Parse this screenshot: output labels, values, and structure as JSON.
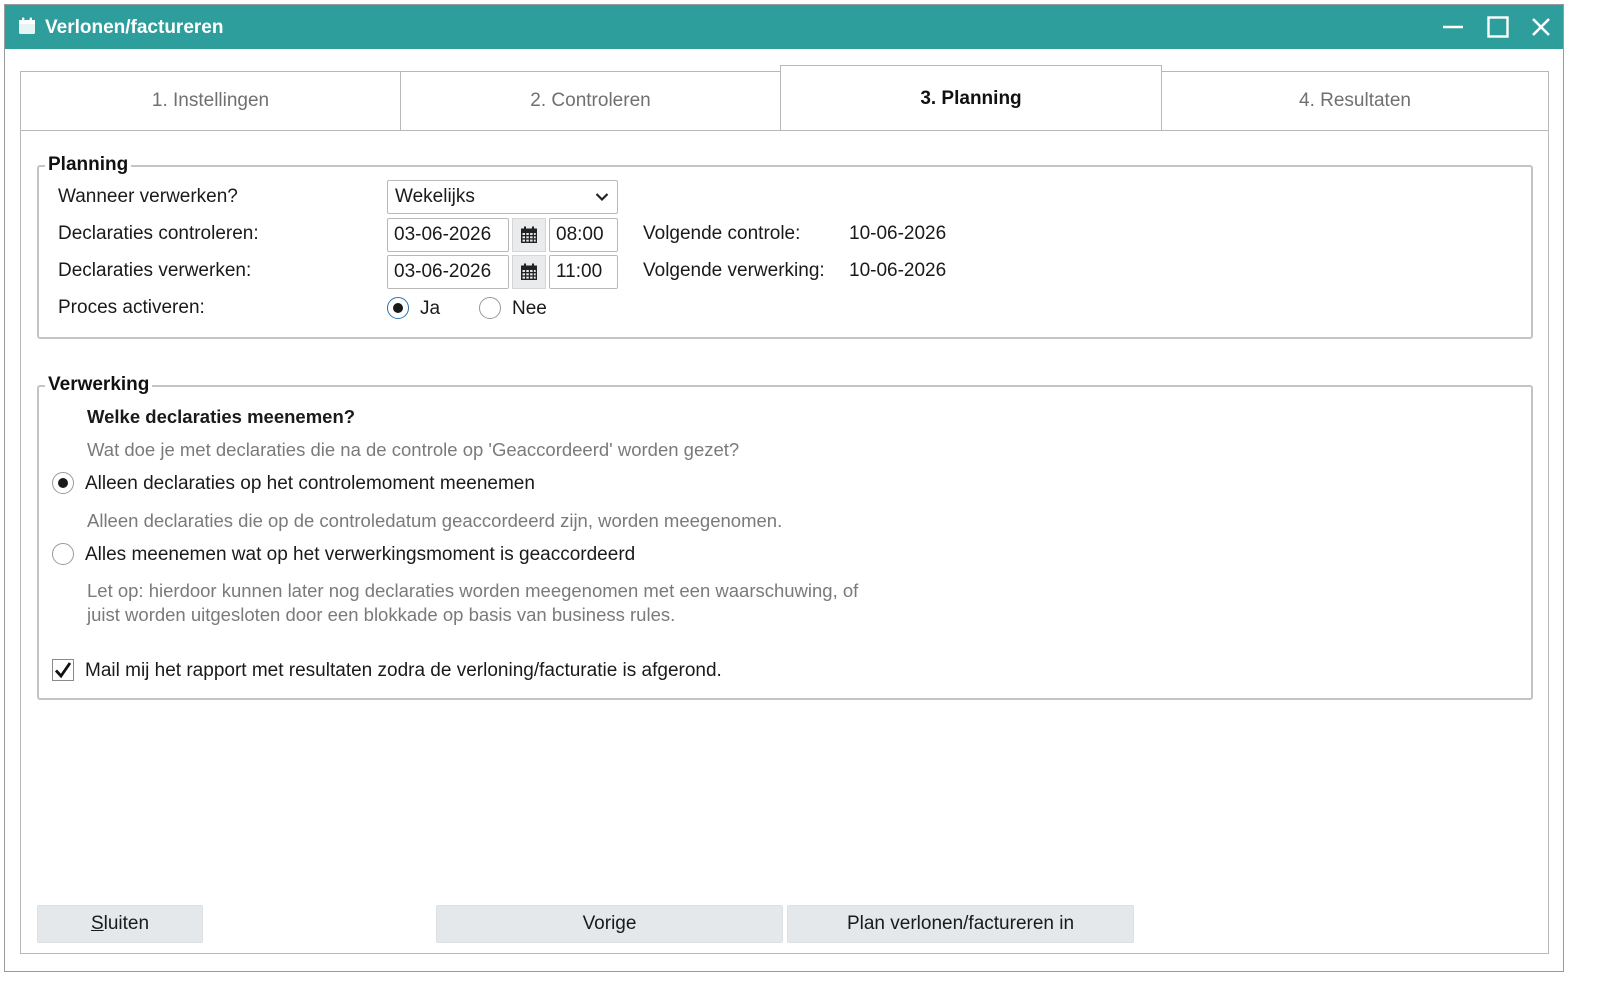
{
  "window": {
    "title": "Verlonen/factureren",
    "accent": "#2e9e9c"
  },
  "tabs": [
    {
      "label": "1. Instellingen",
      "active": false
    },
    {
      "label": "2. Controleren",
      "active": false
    },
    {
      "label": "3. Planning",
      "active": true
    },
    {
      "label": "4. Resultaten",
      "active": false
    }
  ],
  "planning": {
    "legend": "Planning",
    "when_label": "Wanneer verwerken?",
    "when_value": "Wekelijks",
    "check_label": "Declaraties controleren:",
    "check_date": "03-06-2026",
    "check_time": "08:00",
    "next_check_label": "Volgende controle:",
    "next_check_value": "10-06-2026",
    "process_label": "Declaraties verwerken:",
    "process_date": "03-06-2026",
    "process_time": "11:00",
    "next_process_label": "Volgende verwerking:",
    "next_process_value": "10-06-2026",
    "activate_label": "Proces activeren:",
    "activate_yes": "Ja",
    "activate_no": "Nee",
    "activate_selected": "Ja"
  },
  "verwerking": {
    "legend": "Verwerking",
    "question": "Welke declaraties meenemen?",
    "question_help": "Wat doe je met declaraties die na de controle op 'Geaccordeerd' worden gezet?",
    "option1_label": "Alleen declaraties op het controlemoment meenemen",
    "option1_help": "Alleen declaraties die op de controledatum geaccordeerd zijn, worden meegenomen.",
    "option2_label": "Alles meenemen wat op het verwerkingsmoment is geaccordeerd",
    "option2_help_line1": "Let op: hierdoor kunnen later nog declaraties worden meegenomen met een waarschuwing, of",
    "option2_help_line2": "juist worden uitgesloten door een blokkade op basis van business rules.",
    "selected_option": "option1",
    "mail_label": "Mail mij het rapport met resultaten zodra de verloning/facturatie is afgerond.",
    "mail_checked": true
  },
  "footer": {
    "close_mnemonic": "S",
    "close_rest": "luiten",
    "previous_label": "Vorige",
    "plan_label": "Plan verlonen/factureren in"
  }
}
